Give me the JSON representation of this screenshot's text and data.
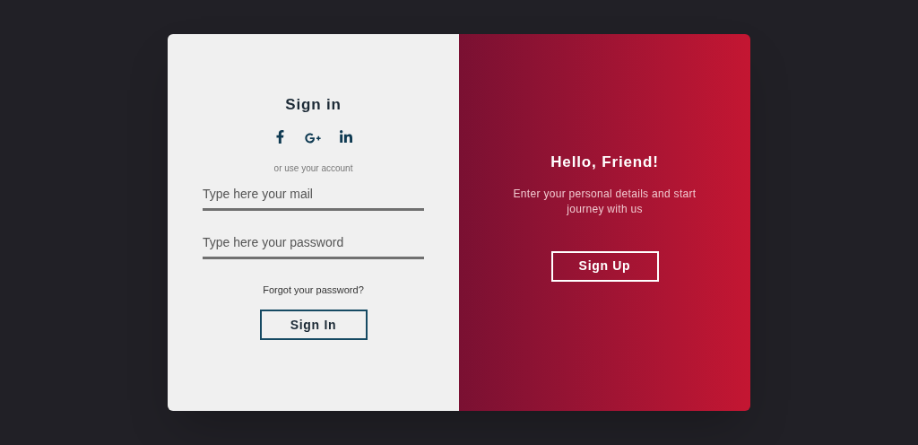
{
  "sign_in": {
    "title": "Sign in",
    "caption": "or use your account",
    "fields": [
      {
        "placeholder": "Type here your mail"
      },
      {
        "placeholder": "Type here your password"
      }
    ],
    "forgot_link": "Forgot your password?",
    "button": "Sign In"
  },
  "overlay": {
    "title": "Hello, Friend!",
    "text": "Enter your personal details and start journey with us",
    "button": "Sign Up"
  }
}
